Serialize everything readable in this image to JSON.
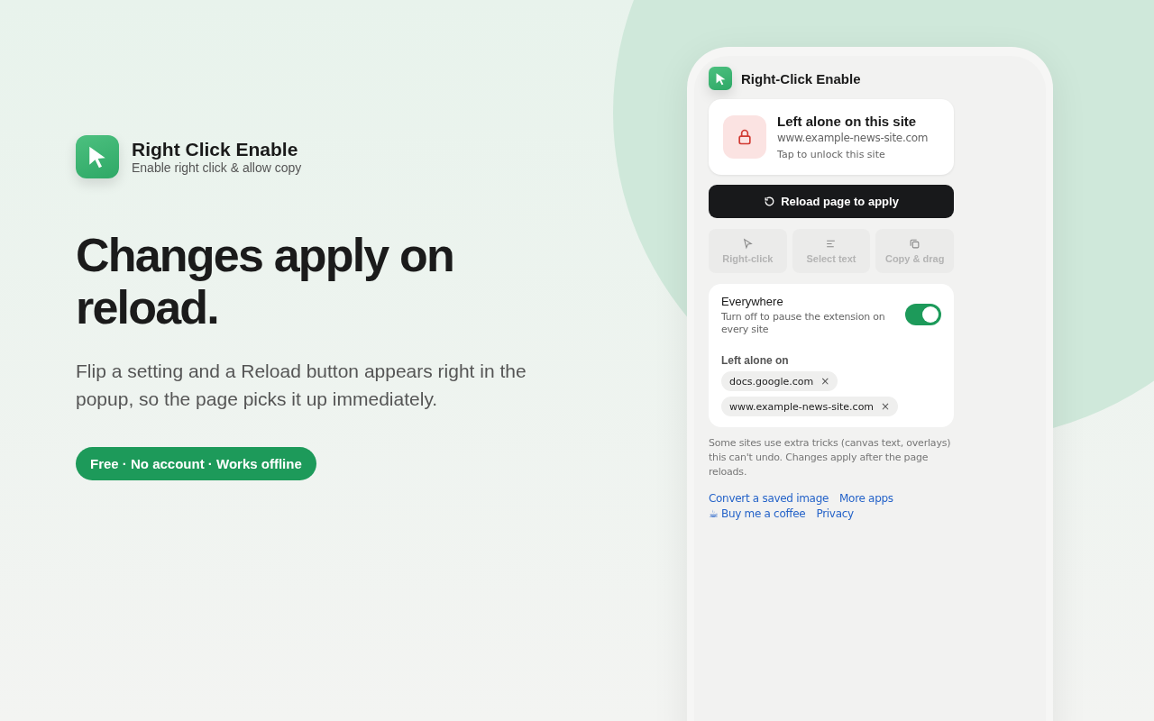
{
  "brand": {
    "name": "Right Click Enable",
    "tagline": "Enable right click & allow copy"
  },
  "headline": "Changes apply on reload.",
  "description": "Flip a setting and a Reload button appears right in the popup, so the page picks it up immediately.",
  "pill": "Free · No account · Works offline",
  "popup": {
    "title": "Right-Click Enable",
    "site_card": {
      "title": "Left alone on this site",
      "domain": "www.example-news-site.com",
      "hint": "Tap to unlock this site"
    },
    "reload_button": "Reload page to apply",
    "features": [
      {
        "kind": "cursor",
        "label": "Right-click",
        "disabled": true
      },
      {
        "kind": "text",
        "label": "Select text",
        "disabled": true
      },
      {
        "kind": "copy",
        "label": "Copy & drag",
        "disabled": true
      }
    ],
    "everywhere": {
      "label": "Everywhere",
      "description": "Turn off to pause the extension on every site",
      "on": true
    },
    "left_alone": {
      "heading": "Left alone on",
      "sites": [
        {
          "domain": "docs.google.com",
          "remove": "×"
        },
        {
          "domain": "www.example-news-site.com",
          "remove": "×"
        }
      ]
    },
    "note": "Some sites use extra tricks (canvas text, overlays) this can't undo. Changes apply after the page reloads.",
    "links": [
      [
        "Convert a saved image",
        "More apps"
      ],
      [
        "☕ Buy me a coffee",
        "Privacy"
      ]
    ]
  }
}
